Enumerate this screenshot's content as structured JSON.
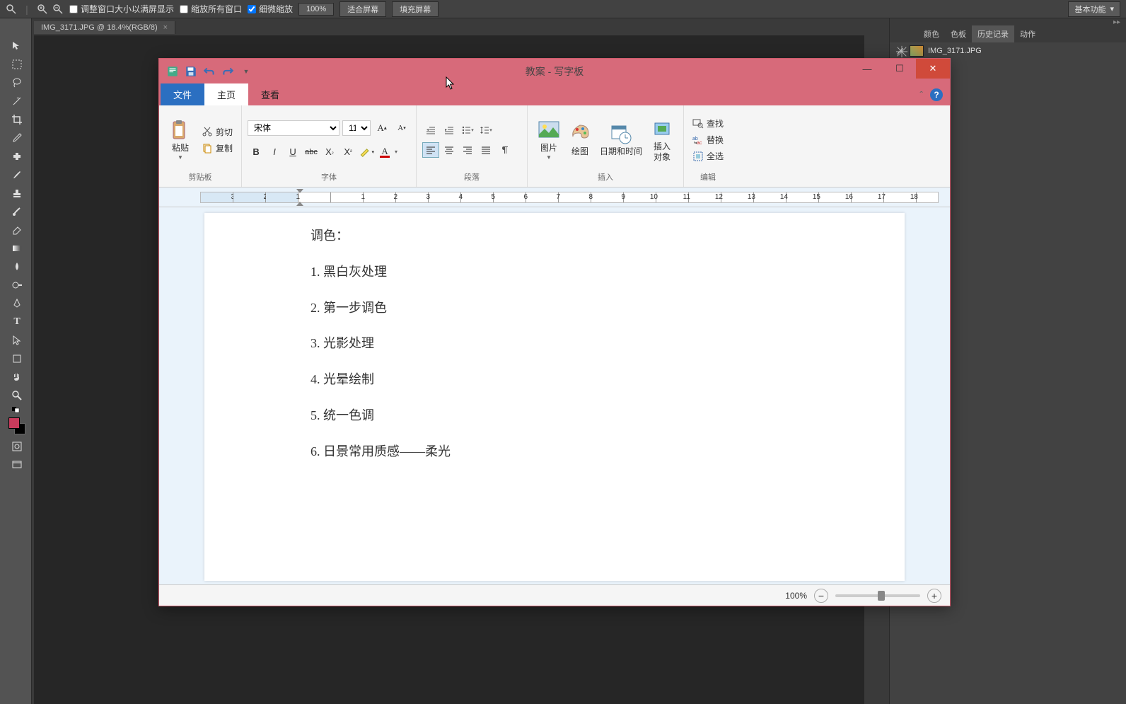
{
  "ps": {
    "top": {
      "resize_to_fit": "调整窗口大小以满屏显示",
      "zoom_all": "缩放所有窗口",
      "fine_zoom": "细微缩放",
      "zoom_100": "100%",
      "fit_screen": "适合屏幕",
      "fill_screen": "填充屏幕",
      "mode": "基本功能"
    },
    "tab": "IMG_3171.JPG @ 18.4%(RGB/8)",
    "right_tabs": {
      "color": "颜色",
      "swatches": "色板",
      "history": "历史记录",
      "actions": "动作"
    },
    "history_item": "IMG_3171.JPG"
  },
  "wordpad": {
    "title": "教案 - 写字板",
    "tabs": {
      "file": "文件",
      "home": "主页",
      "view": "查看"
    },
    "ribbon": {
      "clipboard": {
        "paste": "粘贴",
        "cut": "剪切",
        "copy": "复制",
        "label": "剪贴板"
      },
      "font": {
        "name": "宋体",
        "size": "11",
        "label": "字体"
      },
      "paragraph": {
        "label": "段落"
      },
      "insert": {
        "picture": "图片",
        "paint": "绘图",
        "datetime": "日期和时间",
        "object": "插入\n对象",
        "label": "插入"
      },
      "editing": {
        "find": "查找",
        "replace": "替换",
        "select_all": "全选",
        "label": "编辑"
      }
    },
    "doc": {
      "lines": [
        "调色：",
        "1. 黑白灰处理",
        "2. 第一步调色",
        "3. 光影处理",
        "4. 光晕绘制",
        "5. 统一色调",
        "6. 日景常用质感——柔光"
      ]
    },
    "status": {
      "zoom": "100%"
    }
  }
}
